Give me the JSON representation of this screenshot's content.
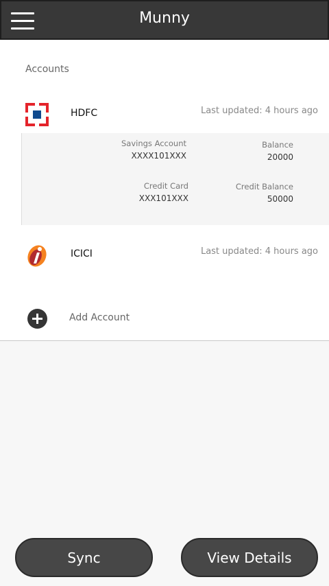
{
  "header": {
    "title": "Munny",
    "menu_icon": "hamburger-menu-icon"
  },
  "accounts_section": {
    "title": "Accounts"
  },
  "banks": [
    {
      "name": "HDFC",
      "logo_icon": "hdfc-logo-icon",
      "updated": "Last updated: 4 hours ago",
      "expanded": true,
      "accounts": [
        {
          "type": "Savings Account",
          "number": "XXXX101XXX",
          "balance_label": "Balance",
          "balance": "20000"
        },
        {
          "type": "Credit Card",
          "number": "XXX101XXX",
          "balance_label": "Credit Balance",
          "balance": "50000"
        }
      ]
    },
    {
      "name": "ICICI",
      "logo_icon": "icici-logo-icon",
      "updated": "Last updated: 4 hours ago",
      "expanded": false
    }
  ],
  "add_account": {
    "label": "Add Account",
    "icon": "plus-circle-icon"
  },
  "buttons": {
    "sync": "Sync",
    "view_details": "View Details"
  },
  "colors": {
    "header_bg": "#383838",
    "button_bg": "#474747",
    "hdfc_red": "#e4242b",
    "hdfc_blue": "#104a8e",
    "icici_orange": "#f58220",
    "icici_red": "#b02a30"
  }
}
